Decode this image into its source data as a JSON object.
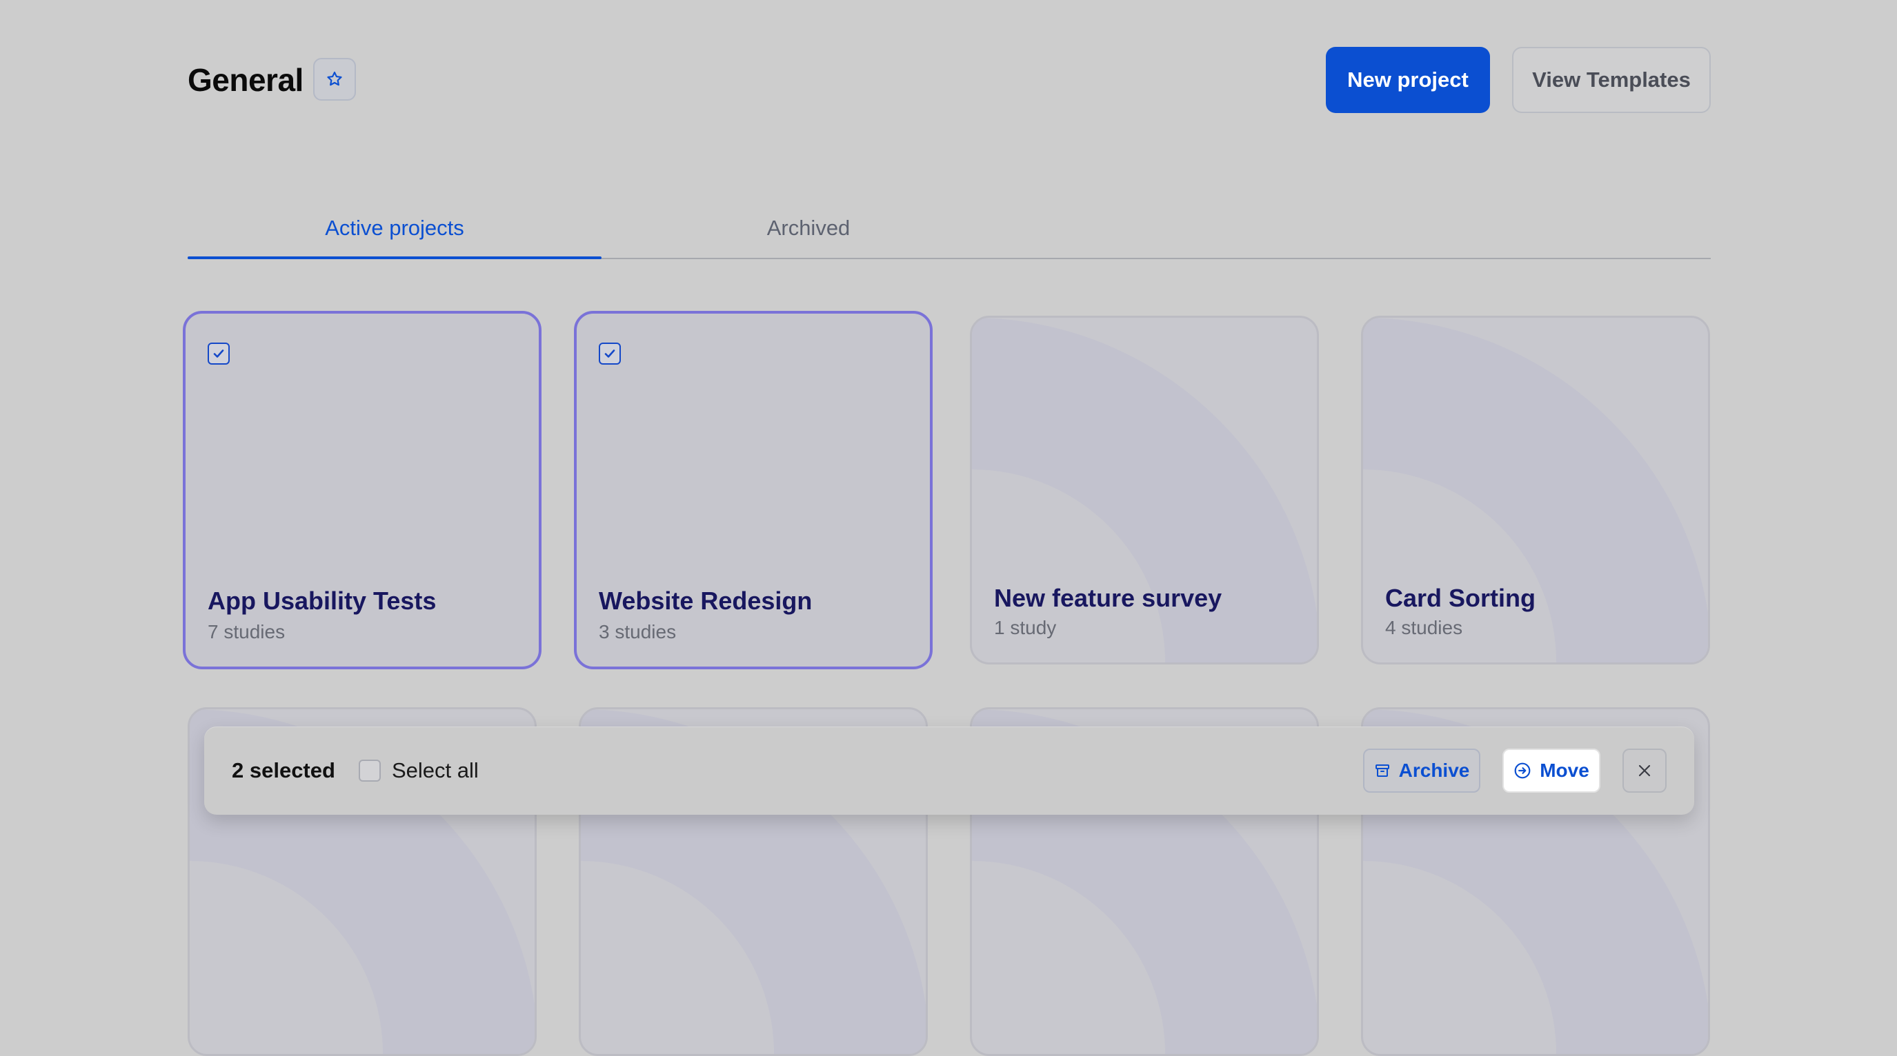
{
  "header": {
    "title": "General",
    "favorite_icon": "star-outline-icon",
    "new_project_label": "New project",
    "view_templates_label": "View Templates"
  },
  "tabs": [
    {
      "label": "Active projects",
      "active": true
    },
    {
      "label": "Archived",
      "active": false
    }
  ],
  "projects": [
    {
      "name": "App Usability Tests",
      "count": "7 studies",
      "selected": true
    },
    {
      "name": "Website Redesign",
      "count": "3 studies",
      "selected": true
    },
    {
      "name": "New feature survey",
      "count": "1 study",
      "selected": false
    },
    {
      "name": "Card Sorting",
      "count": "4 studies",
      "selected": false
    }
  ],
  "selection_bar": {
    "count_label": "2 selected",
    "select_all_label": "Select all",
    "archive_label": "Archive",
    "move_label": "Move",
    "archive_icon": "archive-box-icon",
    "move_icon": "arrow-right-circle-icon",
    "close_icon": "close-icon"
  },
  "colors": {
    "accent": "#0b4fd1",
    "selected_border": "#7a72d8",
    "card_title": "#18175f",
    "background": "#cdcdcd"
  }
}
